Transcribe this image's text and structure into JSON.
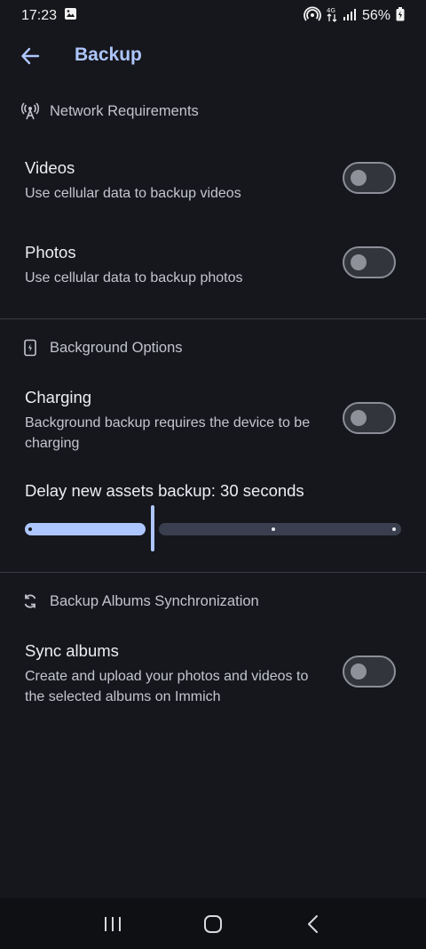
{
  "status_bar": {
    "time": "17:23",
    "battery": "56%",
    "icons": [
      "image-icon",
      "hotspot-icon",
      "data-icon",
      "signal-icon",
      "battery-icon"
    ]
  },
  "header": {
    "title": "Backup",
    "back_icon": "arrow-left-icon"
  },
  "sections": {
    "network": {
      "title": "Network Requirements",
      "icon": "antenna-icon",
      "videos": {
        "title": "Videos",
        "subtitle": "Use cellular data to backup videos",
        "enabled": false
      },
      "photos": {
        "title": "Photos",
        "subtitle": "Use cellular data to backup photos",
        "enabled": false
      }
    },
    "background": {
      "title": "Background Options",
      "icon": "battery-charging-icon",
      "charging": {
        "title": "Charging",
        "subtitle": "Background backup requires the device to be charging",
        "enabled": false
      },
      "delay": {
        "label": "Delay new assets backup: 30 seconds",
        "position": 1,
        "steps": 4
      }
    },
    "sync": {
      "title": "Backup Albums Synchronization",
      "icon": "sync-icon",
      "sync_albums": {
        "title": "Sync albums",
        "subtitle": "Create and upload your photos and videos to the selected albums on Immich",
        "enabled": false
      }
    }
  },
  "nav_bar": {
    "icons": [
      "recent-apps-icon",
      "home-icon",
      "back-icon"
    ]
  },
  "colors": {
    "background": "#16171c",
    "accent": "#aec6ff",
    "track_inactive": "#3a3f4f"
  }
}
